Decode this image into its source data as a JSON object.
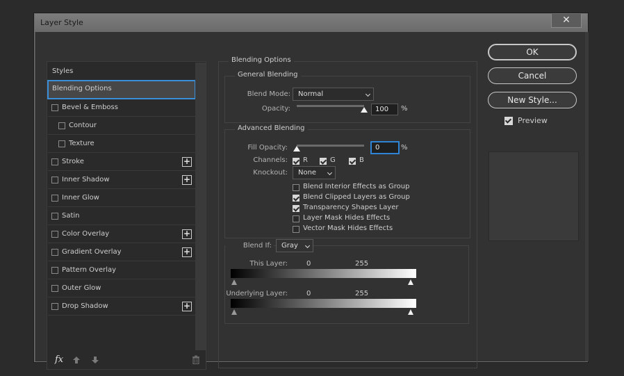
{
  "window": {
    "title": "Layer Style",
    "close": "✕"
  },
  "styles_panel": {
    "items": [
      {
        "label": "Styles",
        "checkbox": false,
        "plus": false,
        "indent": false,
        "selected": false
      },
      {
        "label": "Blending Options",
        "checkbox": false,
        "plus": false,
        "indent": false,
        "selected": true
      },
      {
        "label": "Bevel & Emboss",
        "checkbox": true,
        "plus": false,
        "indent": false,
        "selected": false
      },
      {
        "label": "Contour",
        "checkbox": true,
        "plus": false,
        "indent": true,
        "selected": false
      },
      {
        "label": "Texture",
        "checkbox": true,
        "plus": false,
        "indent": true,
        "selected": false
      },
      {
        "label": "Stroke",
        "checkbox": true,
        "plus": true,
        "indent": false,
        "selected": false
      },
      {
        "label": "Inner Shadow",
        "checkbox": true,
        "plus": true,
        "indent": false,
        "selected": false
      },
      {
        "label": "Inner Glow",
        "checkbox": true,
        "plus": false,
        "indent": false,
        "selected": false
      },
      {
        "label": "Satin",
        "checkbox": true,
        "plus": false,
        "indent": false,
        "selected": false
      },
      {
        "label": "Color Overlay",
        "checkbox": true,
        "plus": true,
        "indent": false,
        "selected": false
      },
      {
        "label": "Gradient Overlay",
        "checkbox": true,
        "plus": true,
        "indent": false,
        "selected": false
      },
      {
        "label": "Pattern Overlay",
        "checkbox": true,
        "plus": false,
        "indent": false,
        "selected": false
      },
      {
        "label": "Outer Glow",
        "checkbox": true,
        "plus": false,
        "indent": false,
        "selected": false
      },
      {
        "label": "Drop Shadow",
        "checkbox": true,
        "plus": true,
        "indent": false,
        "selected": false
      }
    ],
    "plus_symbol": "+",
    "fx_label": "fx",
    "icons": [
      "fx-icon",
      "arrow-up-icon",
      "arrow-down-icon",
      "trash-icon"
    ]
  },
  "blending": {
    "section_title": "Blending Options",
    "general": {
      "title": "General Blending",
      "blend_mode_label": "Blend Mode:",
      "blend_mode_value": "Normal",
      "opacity_label": "Opacity:",
      "opacity_value": "100",
      "opacity_fraction": 1.0,
      "pct": "%"
    },
    "advanced": {
      "title": "Advanced Blending",
      "fill_opacity_label": "Fill Opacity:",
      "fill_opacity_value": "0",
      "fill_opacity_fraction": 0.0,
      "pct": "%",
      "channels_label": "Channels:",
      "channels": [
        {
          "label": "R",
          "checked": true
        },
        {
          "label": "G",
          "checked": true
        },
        {
          "label": "B",
          "checked": true
        }
      ],
      "knockout_label": "Knockout:",
      "knockout_value": "None",
      "options": [
        {
          "label": "Blend Interior Effects as Group",
          "checked": false
        },
        {
          "label": "Blend Clipped Layers as Group",
          "checked": true
        },
        {
          "label": "Transparency Shapes Layer",
          "checked": true
        },
        {
          "label": "Layer Mask Hides Effects",
          "checked": false
        },
        {
          "label": "Vector Mask Hides Effects",
          "checked": false
        }
      ]
    },
    "blend_if": {
      "label": "Blend If:",
      "value": "Gray",
      "this_layer": {
        "label": "This Layer:",
        "low": "0",
        "high": "255"
      },
      "underlying_layer": {
        "label": "Underlying Layer:",
        "low": "0",
        "high": "255"
      }
    }
  },
  "buttons": {
    "ok": "OK",
    "cancel": "Cancel",
    "new_style": "New Style..."
  },
  "preview": {
    "label": "Preview",
    "checked": true
  },
  "colors": {
    "selected_border": "#3b8fd9",
    "panel_bg": "#323232",
    "list_bg": "#2a2a2a"
  }
}
